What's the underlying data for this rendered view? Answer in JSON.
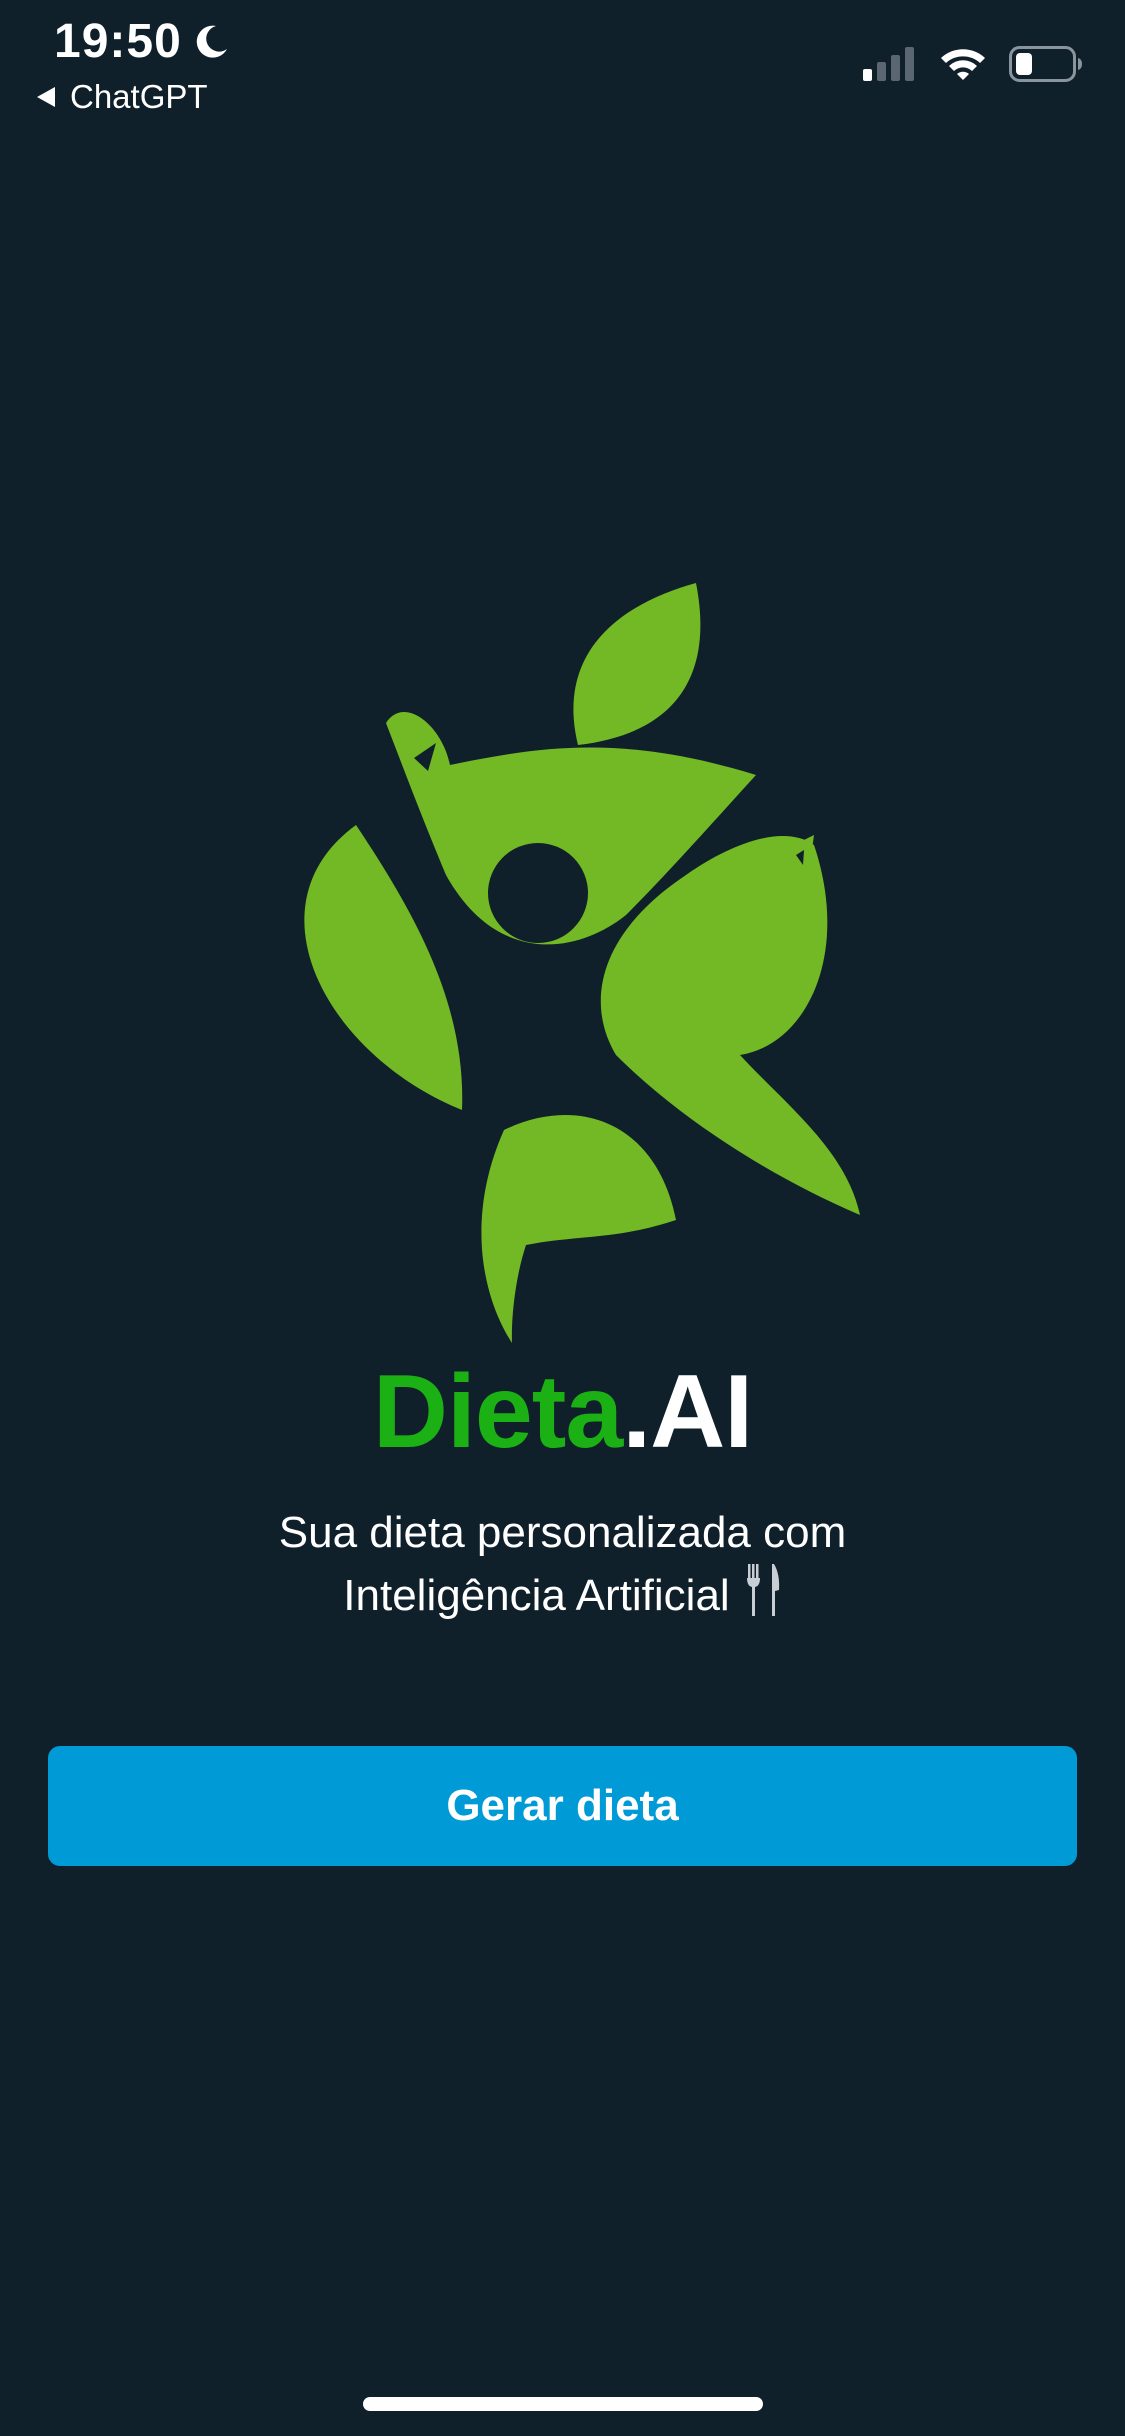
{
  "status_bar": {
    "time": "19:50",
    "back_app_label": "ChatGPT",
    "icons": [
      "moon-icon",
      "back-triangle-icon",
      "signal-icon",
      "wifi-icon",
      "battery-icon"
    ]
  },
  "brand": {
    "name_part1": "Dieta",
    "name_part2": ".AI",
    "accent_color": "#1bb114",
    "logo_icon": "leaf-person-logo"
  },
  "tagline": {
    "line1": "Sua dieta personalizada com",
    "line2": "Inteligência Artificial"
  },
  "cta": {
    "label": "Gerar dieta",
    "color": "#009bd6"
  },
  "theme": {
    "background": "#10202b"
  }
}
